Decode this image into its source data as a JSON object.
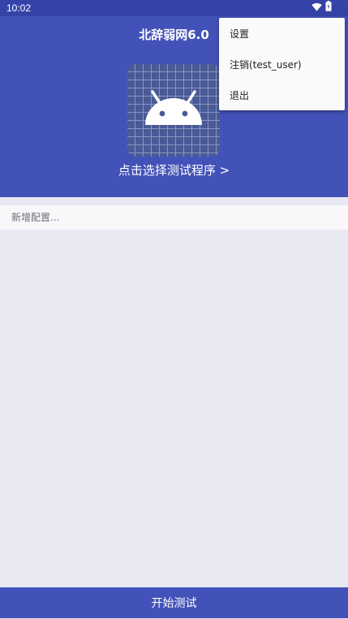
{
  "status_bar": {
    "time": "10:02",
    "icons": [
      "wifi-icon",
      "battery-icon"
    ]
  },
  "app": {
    "title": "北辞弱网6.0"
  },
  "program": {
    "icon": "android-icon",
    "select_label": "点击选择测试程序 >"
  },
  "config": {
    "placeholder": "新增配置..."
  },
  "menu": {
    "items": [
      {
        "label": "设置"
      },
      {
        "label": "注销(test_user)"
      },
      {
        "label": "退出"
      }
    ]
  },
  "actions": {
    "start_label": "开始测试"
  },
  "colors": {
    "primary": "#4352b8",
    "status_bar": "#3543a8",
    "background": "#e8e9f2",
    "menu_background": "#fafafa"
  }
}
